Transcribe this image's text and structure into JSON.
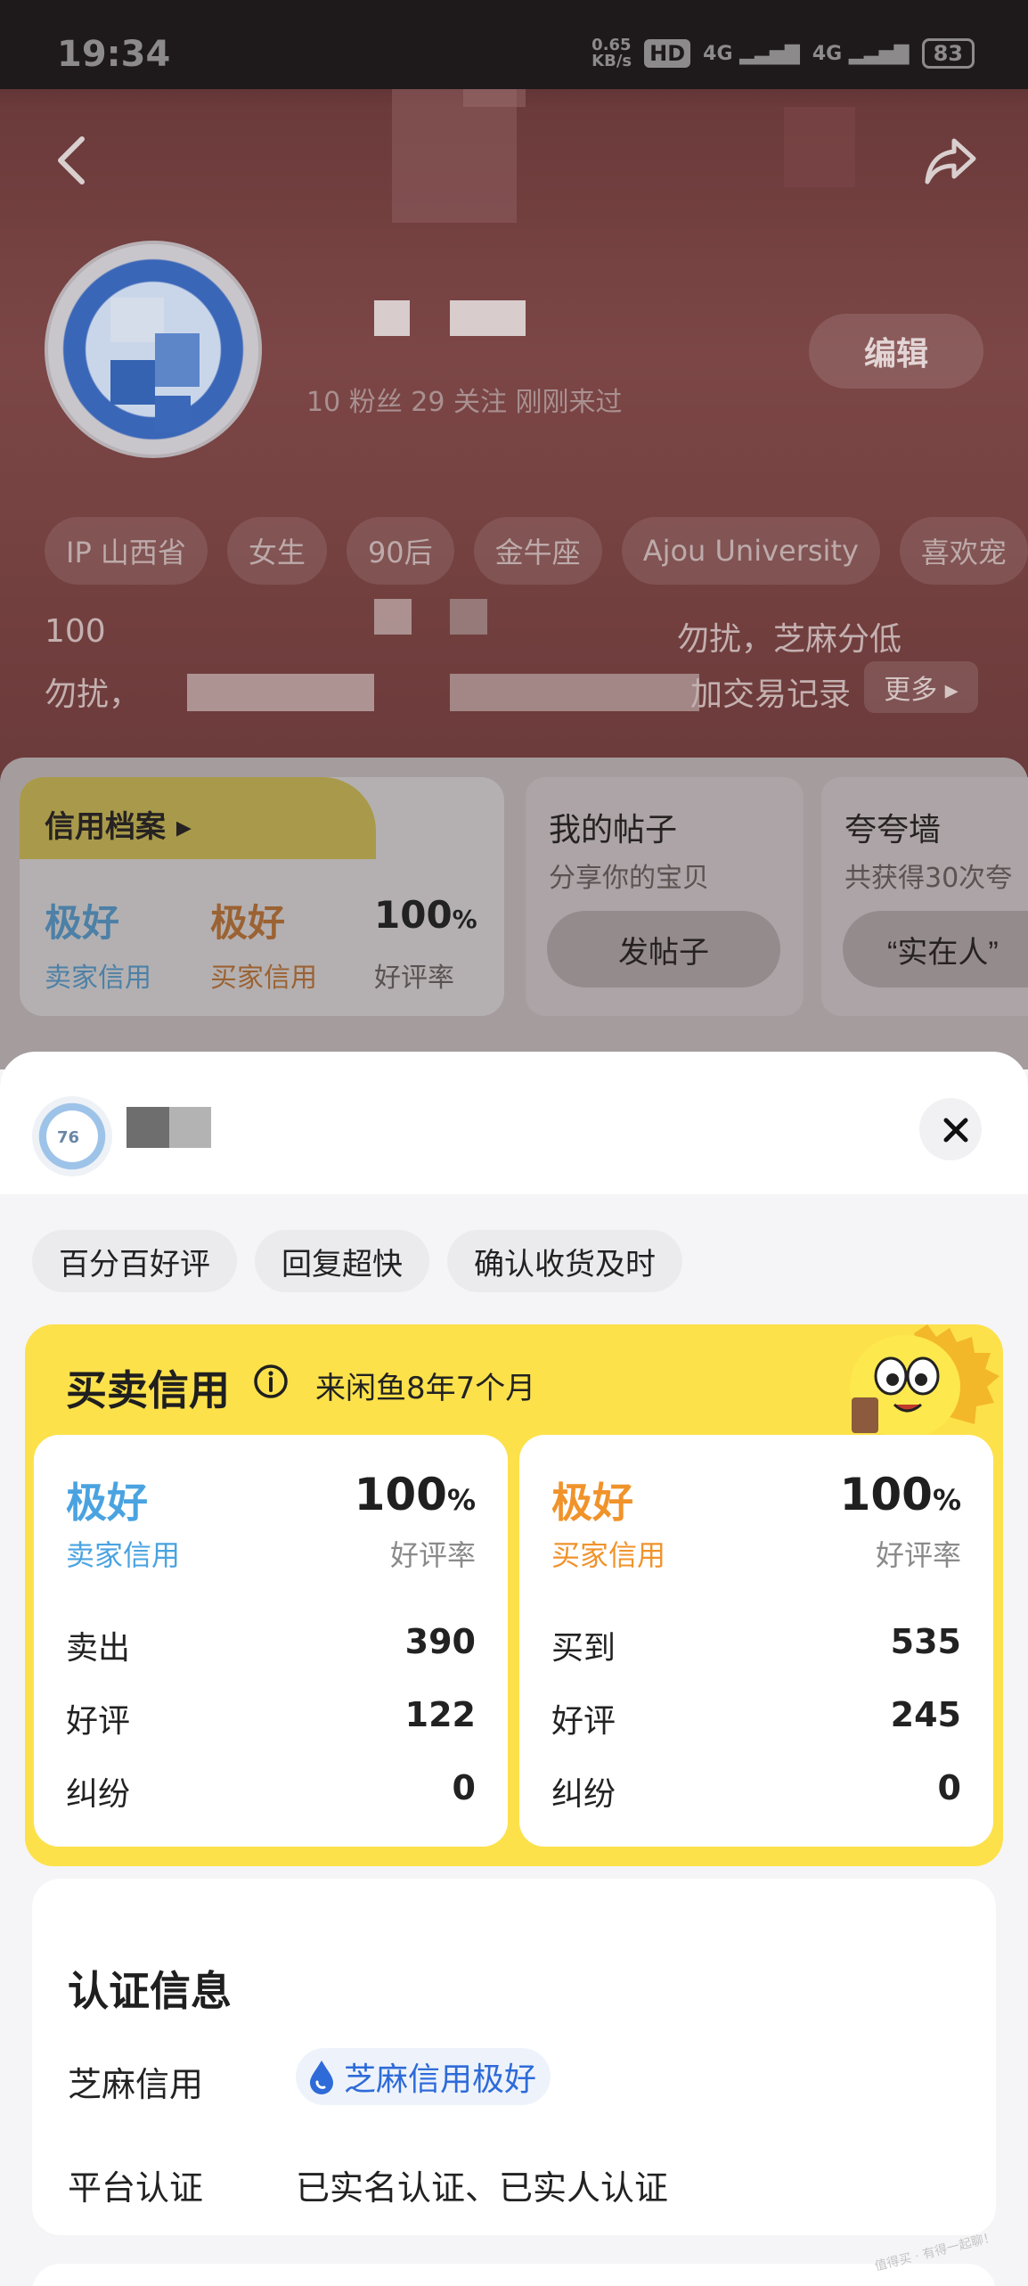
{
  "status_bar": {
    "time": "19:34",
    "net_speed": "0.65\nKB/s",
    "hd": "HD",
    "signal_1": "4G",
    "signal_2": "4G",
    "battery": "83"
  },
  "profile": {
    "stats": "10 粉丝  29 关注  刚刚来过",
    "edit_label": "编辑",
    "tags": [
      "IP 山西省",
      "女生",
      "90后",
      "金牛座",
      "Ajou University",
      "喜欢宠"
    ],
    "bio_line_1_start": "100",
    "bio_line_1_end": "勿扰，芝麻分低",
    "bio_line_2_start": "勿扰，",
    "bio_line_2_end": "加交易记录",
    "more_label": "更多 ▸"
  },
  "cards": {
    "credit": {
      "title": "信用档案 ▸",
      "seller_level": "极好",
      "seller_label": "卖家信用",
      "buyer_level": "极好",
      "buyer_label": "买家信用",
      "rate": "100",
      "rate_unit": "%",
      "rate_label": "好评率"
    },
    "posts": {
      "title": "我的帖子",
      "subtitle": "分享你的宝贝",
      "button": "发帖子"
    },
    "praise": {
      "title": "夸夸墙",
      "subtitle": "共获得30次夸",
      "button": "“实在人”"
    }
  },
  "sheet": {
    "avatar_number": "76",
    "tags": [
      "百分百好评",
      "回复超快",
      "确认收货及时"
    ],
    "trade": {
      "title": "买卖信用",
      "since": "来闲鱼8年7个月",
      "seller": {
        "level": "极好",
        "level_label": "卖家信用",
        "rate": "100",
        "rate_unit": "%",
        "rate_label": "好评率",
        "rows": [
          {
            "label": "卖出",
            "value": "390"
          },
          {
            "label": "好评",
            "value": "122"
          },
          {
            "label": "纠纷",
            "value": "0"
          }
        ]
      },
      "buyer": {
        "level": "极好",
        "level_label": "买家信用",
        "rate": "100",
        "rate_unit": "%",
        "rate_label": "好评率",
        "rows": [
          {
            "label": "买到",
            "value": "535"
          },
          {
            "label": "好评",
            "value": "245"
          },
          {
            "label": "纠纷",
            "value": "0"
          }
        ]
      }
    },
    "verify": {
      "title": "认证信息",
      "sesame_label": "芝麻信用",
      "sesame_value": "芝麻信用极好",
      "platform_label": "平台认证",
      "platform_value": "已实名认证、已实人认证"
    }
  },
  "watermark": "值得买 · 有得一起聊！",
  "colors": {
    "seller_blue": "#4aa3e0",
    "buyer_orange": "#f0932b",
    "card_yellow": "#fce14b",
    "sesame_blue": "#2e6bd8"
  }
}
